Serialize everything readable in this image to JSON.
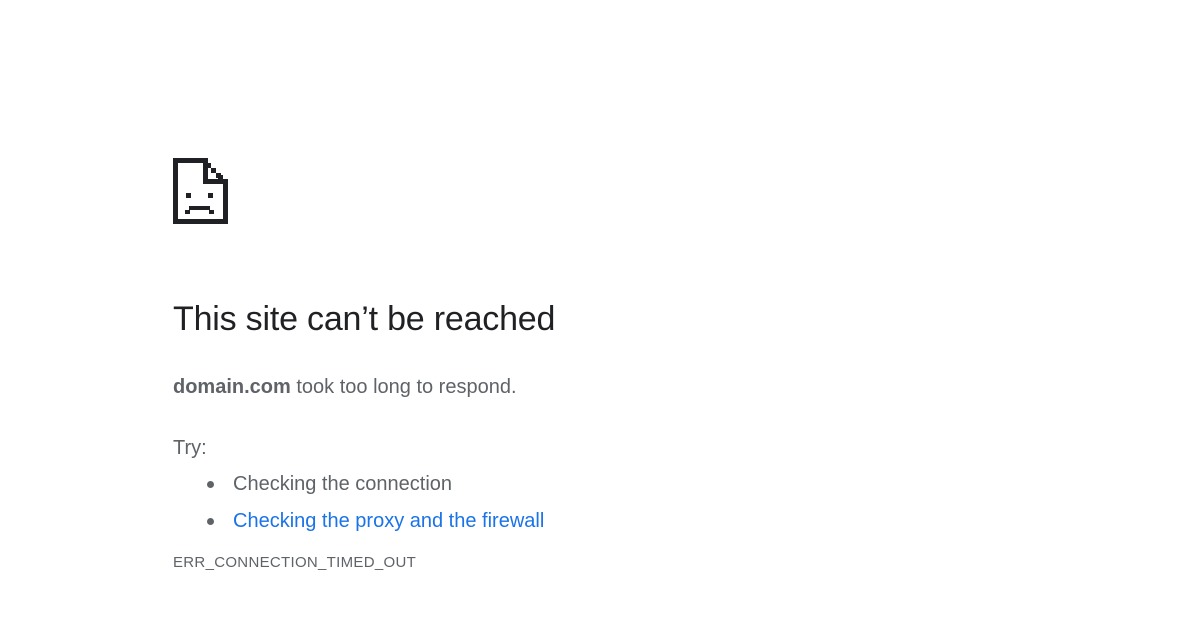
{
  "error_page": {
    "icon": "sad-page-icon",
    "title": "This site can’t be reached",
    "domain": "domain.com",
    "summary_suffix": " took too long to respond.",
    "try_label": "Try:",
    "suggestions": [
      {
        "label": "Checking the connection",
        "is_link": false
      },
      {
        "label": "Checking the proxy and the firewall",
        "is_link": true
      }
    ],
    "error_code": "ERR_CONNECTION_TIMED_OUT"
  },
  "colors": {
    "title": "#202124",
    "body_text": "#5f6368",
    "link": "#1a73e8",
    "background": "#ffffff"
  }
}
